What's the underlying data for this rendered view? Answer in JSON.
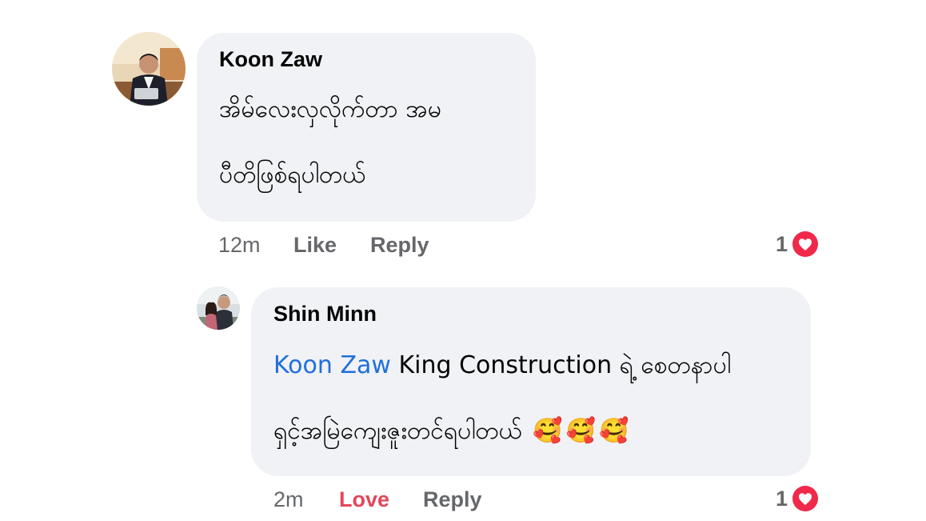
{
  "comments": [
    {
      "author": "Koon Zaw",
      "lines": [
        "အိမ်လေးလှလိုက်တာ အမ",
        "ပီတိဖြစ်ရပါတယ်"
      ],
      "time": "12m",
      "like_label": "Like",
      "reply_label": "Reply",
      "reaction_count": "1",
      "reaction_icon": "heart-icon"
    },
    {
      "author": "Shin Minn",
      "mention": "Koon Zaw",
      "lines": [
        "King Construction ရဲ့ စေတနာပါ",
        "ရှင့်အမြဲကျေးဇူးတင်ရပါတယ်"
      ],
      "emojis": [
        "🥰",
        "🥰",
        "🥰"
      ],
      "time": "2m",
      "like_label": "Love",
      "reply_label": "Reply",
      "reaction_count": "1",
      "reaction_icon": "heart-icon"
    }
  ],
  "colors": {
    "bubble": "#f0f2f5",
    "meta": "#65676b",
    "mention": "#216fdb",
    "love": "#e4465a",
    "heart": "#f0284a"
  }
}
